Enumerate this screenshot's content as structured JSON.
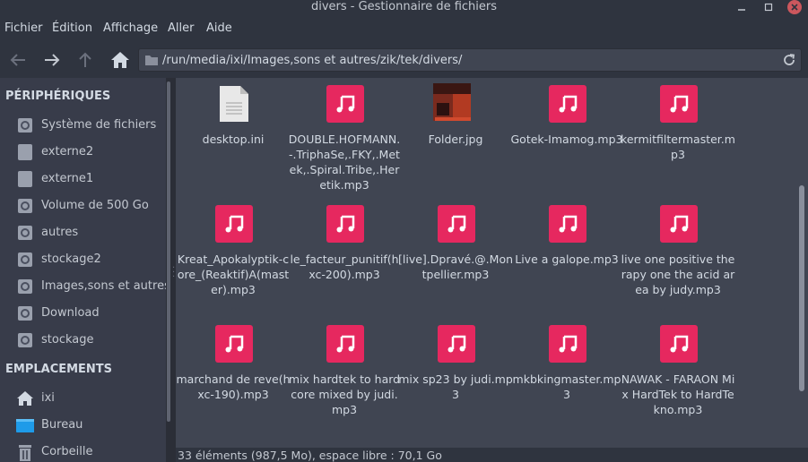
{
  "window": {
    "title": "divers - Gestionnaire de fichiers"
  },
  "menu": [
    "Fichier",
    "Édition",
    "Affichage",
    "Aller",
    "Aide"
  ],
  "toolbar": {
    "back_icon": "arrow-left-icon",
    "forward_icon": "arrow-right-icon",
    "up_icon": "arrow-up-icon",
    "home_icon": "home-icon",
    "path": "/run/media/ixi/Images,sons et autres/zik/tek/divers/",
    "reload_icon": "reload-icon"
  },
  "sidebar": {
    "devices_header": "PÉRIPHÉRIQUES",
    "devices": [
      {
        "label": "Système de fichiers",
        "icon": "disk-icon"
      },
      {
        "label": "externe2",
        "icon": "drive-icon"
      },
      {
        "label": "externe1",
        "icon": "drive-icon"
      },
      {
        "label": "Volume de 500 Go",
        "icon": "disk-icon"
      },
      {
        "label": "autres",
        "icon": "disk-icon"
      },
      {
        "label": "stockage2",
        "icon": "disk-icon"
      },
      {
        "label": "Images,sons et autres",
        "icon": "disk-icon"
      },
      {
        "label": "Download",
        "icon": "disk-icon"
      },
      {
        "label": "stockage",
        "icon": "disk-icon"
      }
    ],
    "places_header": "EMPLACEMENTS",
    "places": [
      {
        "label": "ixi",
        "icon": "home-icon"
      },
      {
        "label": "Bureau",
        "icon": "desktop-folder-icon"
      },
      {
        "label": "Corbeille",
        "icon": "trash-icon"
      }
    ]
  },
  "files": [
    {
      "name": "desktop.ini",
      "type": "text"
    },
    {
      "name": "DOUBLE.HOFMANN.-.TriphaSe,.FKY,.Metek,.Spiral.Tribe,.Heretik.mp3",
      "type": "audio"
    },
    {
      "name": "Folder.jpg",
      "type": "image"
    },
    {
      "name": "Gotek-Imamog.mp3",
      "type": "audio"
    },
    {
      "name": "kermitfiltermaster.mp3",
      "type": "audio"
    },
    {
      "name": "Kreat_Apokalyptik-core_(Reaktif)A(master).mp3",
      "type": "audio"
    },
    {
      "name": "le_facteur_punitif(hxc-200).mp3",
      "type": "audio"
    },
    {
      "name": "[live].Dpravé.@.Montpellier.mp3",
      "type": "audio"
    },
    {
      "name": "Live a galope.mp3",
      "type": "audio"
    },
    {
      "name": "live one positive therapy one the acid area by judy.mp3",
      "type": "audio"
    },
    {
      "name": "marchand de reve(hxc-190).mp3",
      "type": "audio"
    },
    {
      "name": "mix hardtek to hardcore mixed by judi.mp3",
      "type": "audio"
    },
    {
      "name": "mix sp23 by judi.mp3",
      "type": "audio"
    },
    {
      "name": "mkbkingmaster.mp3",
      "type": "audio"
    },
    {
      "name": "NAWAK - FARAON Mix HardTek to HardTekno.mp3",
      "type": "audio"
    }
  ],
  "status": "33 éléments (987,5 Mo), espace libre : 70,1 Go",
  "colors": {
    "accent": "#e6285f",
    "content_bg": "#404552",
    "sidebar_bg": "#383c4a"
  }
}
